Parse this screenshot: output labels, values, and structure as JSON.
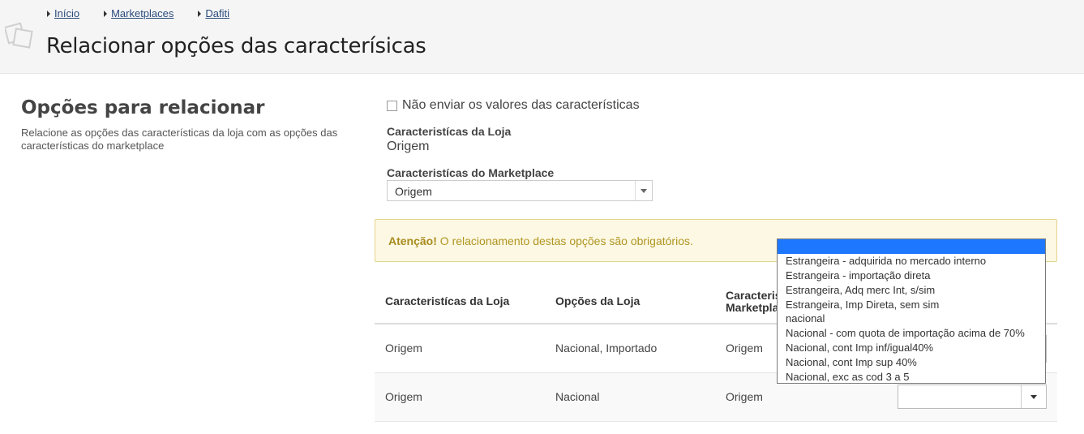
{
  "breadcrumb": [
    {
      "label": "Início"
    },
    {
      "label": "Marketplaces"
    },
    {
      "label": "Dafiti"
    }
  ],
  "page_title": "Relacionar opções das caracterísicas",
  "section": {
    "title": "Opções para relacionar",
    "description": "Relacione as opções das características da loja com as opções das características do marketplace"
  },
  "checkbox": {
    "label": "Não enviar os valores das características",
    "checked": false
  },
  "store_char": {
    "label": "Caracteristícas da Loja",
    "value": "Origem"
  },
  "marketplace_char": {
    "label": "Caracteristícas do Marketplace",
    "selected": "Origem"
  },
  "alert": {
    "strong": "Atenção!",
    "text": " O relacionamento destas opções são obrigatórios."
  },
  "table": {
    "headers": [
      "Caracteristícas da Loja",
      "Opções da Loja",
      "Caracteris",
      "Marketpla"
    ],
    "rows": [
      {
        "store_char": "Origem",
        "store_options": "Nacional, Importado",
        "marketplace_char": "Origem"
      },
      {
        "store_char": "Origem",
        "store_options": "Nacional",
        "marketplace_char": "Origem"
      }
    ]
  },
  "dropdown": {
    "options": [
      "",
      "Estrangeira - adquirida no mercado interno",
      "Estrangeira - importação direta",
      "Estrangeira, Adq merc Int, s/sim",
      "Estrangeira, Imp Direta, sem sim",
      "nacional",
      "Nacional - com quota de importação acima de 70%",
      "Nacional, cont Imp inf/igual40%",
      "Nacional, cont Imp sup 40%",
      "Nacional, exc as cod 3 a 5"
    ],
    "highlighted_index": 0
  },
  "colors": {
    "link": "#2a4b7c",
    "alert_bg": "#fcf8e3",
    "alert_text": "#b09522",
    "highlight": "#1e78ff"
  }
}
